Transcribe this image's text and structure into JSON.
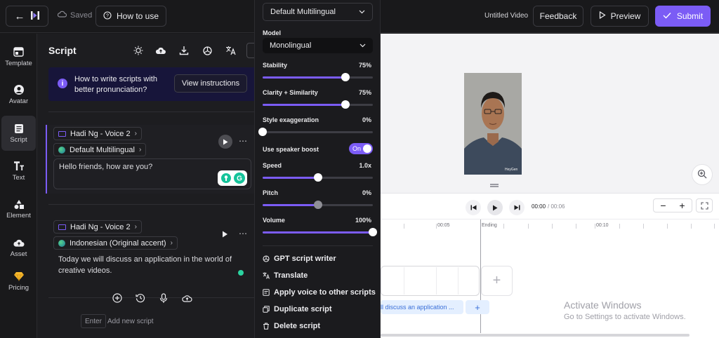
{
  "topbar": {
    "saved_label": "Saved",
    "how_to_label": "How to use",
    "video_title": "Untitled Video",
    "feedback_label": "Feedback",
    "preview_label": "Preview",
    "submit_label": "Submit",
    "accent_color": "#7b5cf5"
  },
  "nav": {
    "items": [
      {
        "label": "Template",
        "icon": "template-icon"
      },
      {
        "label": "Avatar",
        "icon": "avatar-icon"
      },
      {
        "label": "Script",
        "icon": "script-icon",
        "active": true
      },
      {
        "label": "Text",
        "icon": "text-icon"
      },
      {
        "label": "Element",
        "icon": "element-icon"
      },
      {
        "label": "Asset",
        "icon": "asset-icon"
      },
      {
        "label": "Pricing",
        "icon": "diamond-icon"
      }
    ]
  },
  "script_panel": {
    "title": "Script",
    "tip_text": "How to write scripts with better pronunciation?",
    "tip_button": "View instructions",
    "blocks": [
      {
        "voice": "Hadi Ng - Voice 2",
        "language": "Default Multilingual",
        "text": "Hello friends, how are you?"
      },
      {
        "voice": "Hadi Ng - Voice 2",
        "language": "Indonesian (Original accent)",
        "text": "Today we will discuss an application in the world of creative videos."
      }
    ],
    "enter_key": "Enter",
    "add_new_script": "Add new script"
  },
  "voice_settings": {
    "language_select": "Default Multilingual",
    "model_label": "Model",
    "model_value": "Monolingual",
    "stability": {
      "label": "Stability",
      "value": "75%",
      "fraction": 0.75
    },
    "clarity": {
      "label": "Clarity + Similarity",
      "value": "75%",
      "fraction": 0.75
    },
    "style": {
      "label": "Style exaggeration",
      "value": "0%",
      "fraction": 0.0
    },
    "speaker_boost": {
      "label": "Use speaker boost",
      "state": "On"
    },
    "speed": {
      "label": "Speed",
      "value": "1.0x",
      "fraction": 0.5
    },
    "pitch": {
      "label": "Pitch",
      "value": "0%",
      "fraction": 0.5
    },
    "volume": {
      "label": "Volume",
      "value": "100%",
      "fraction": 1.0
    },
    "menu": [
      {
        "label": "GPT script writer",
        "icon": "openai-icon"
      },
      {
        "label": "Translate",
        "icon": "translate-icon"
      },
      {
        "label": "Apply voice to other scripts",
        "icon": "apply-voice-icon"
      },
      {
        "label": "Duplicate script",
        "icon": "duplicate-icon"
      },
      {
        "label": "Delete script",
        "icon": "trash-icon"
      }
    ]
  },
  "canvas": {
    "watermark_text": "HeyGen"
  },
  "timeline": {
    "current_time": "00:00",
    "total_time": "/ 00:06",
    "ticks": [
      "00:05",
      "Ending",
      "00:10"
    ],
    "script_chip": "ll discuss an application ...",
    "activate_title": "Activate Windows",
    "activate_sub": "Go to Settings to activate Windows."
  }
}
